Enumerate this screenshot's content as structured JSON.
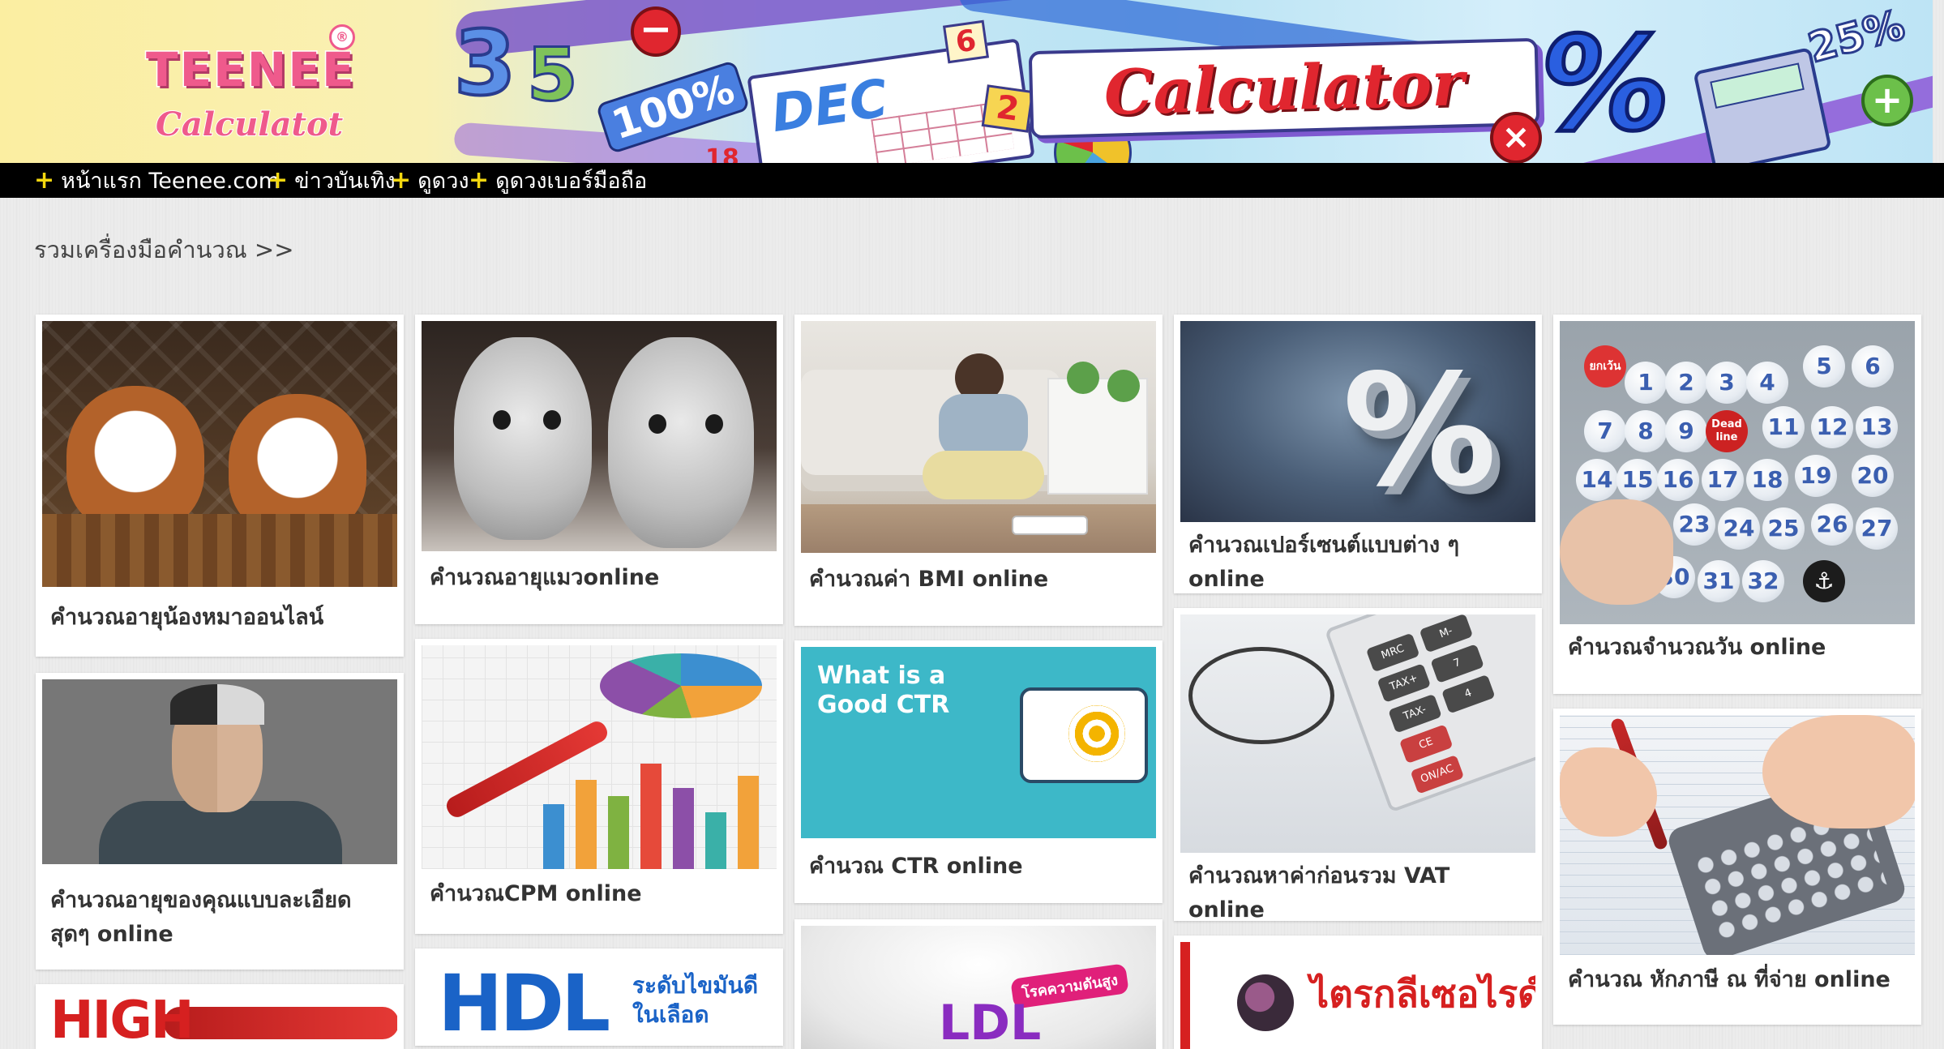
{
  "banner": {
    "logo_word": "TEENEE",
    "logo_subtitle": "Calculatot",
    "logo_mark": "®",
    "title": "Calculator"
  },
  "nav": {
    "items": [
      {
        "label": "หน้าแรก Teenee.com"
      },
      {
        "label": "ข่าวบันเทิง"
      },
      {
        "label": "ดูดวง"
      },
      {
        "label": "ดูดวงเบอร์มือถือ"
      }
    ],
    "plus_glyph": "+"
  },
  "section": {
    "heading": "รวมเครื่องมือคำนวณ >>"
  },
  "cards": [
    {
      "title": "คำนวณอายุน้องหมาออนไลน์",
      "image": "puppies"
    },
    {
      "title": "คำนวณอายุของคุณแบบละเอียดสุดๆ online",
      "image": "man-half-face"
    },
    {
      "title": "",
      "image": "high-arrow",
      "image_text": "HIGH"
    },
    {
      "title": "คำนวณอายุแมวonline",
      "image": "kittens"
    },
    {
      "title": "คำนวณCPM online",
      "image": "chart-with-pen"
    },
    {
      "title": "",
      "image": "hdl",
      "image_text": "HDL",
      "image_subtext": "ระดับไขมันดี ในเลือด"
    },
    {
      "title": "คำนวณค่า BMI online",
      "image": "woman-on-scale"
    },
    {
      "title": "คำนวณ CTR online",
      "image": "ctr-tablet",
      "image_text": "What is a Good CTR"
    },
    {
      "title": "",
      "image": "ldl",
      "image_text": "LDL",
      "image_subtext": "โรคความดันสูง"
    },
    {
      "title": "คำนวณเปอร์เซนต์แบบต่าง ๆ online",
      "image": "percent-symbol",
      "image_text": "%"
    },
    {
      "title": "คำนวณหาค่าก่อนรวม VAT online",
      "image": "calculator-glasses"
    },
    {
      "title": "",
      "image": "triglyceride",
      "image_text": "ไตรกลีเซอไรด์"
    },
    {
      "title": "คำนวณจำนวณวัน online",
      "image": "calendar-buttons"
    },
    {
      "title": "คำนวณ หักภาษี ณ ที่จ่าย online",
      "image": "hands-calculator"
    }
  ],
  "colors": {
    "nav_bg": "#000000",
    "nav_plus": "#f3d70f",
    "page_bg": "#ececec",
    "caption_text": "#333333"
  }
}
